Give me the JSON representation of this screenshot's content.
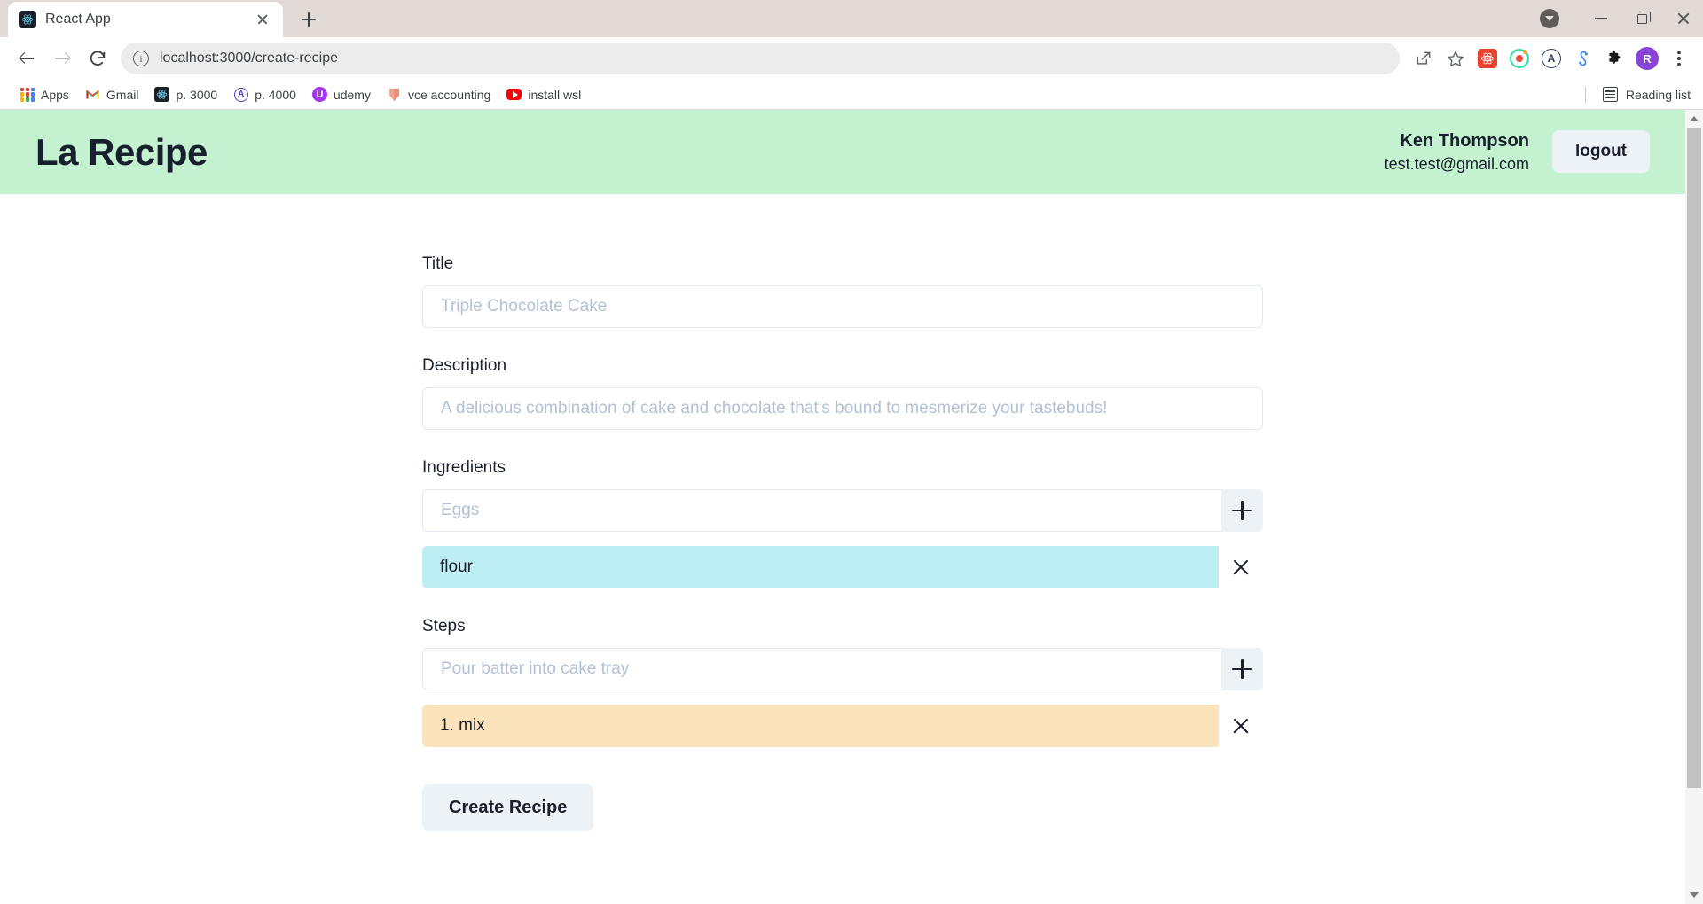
{
  "browser": {
    "tab": {
      "title": "React App",
      "favicon": "react-icon",
      "close_label": "Close tab"
    },
    "new_tab_label": "+",
    "window_controls": {
      "tab_search": "tab-search",
      "minimize": "minimize",
      "maximize": "maximize",
      "close": "close"
    },
    "nav": {
      "back": "back",
      "forward": "forward",
      "reload": "reload"
    },
    "omnibox": {
      "url": "localhost:3000/create-recipe",
      "info_icon": "info-circle-icon",
      "share_icon": "share-icon",
      "star_icon": "star-icon"
    },
    "extensions": [
      {
        "name": "react-devtools",
        "glyph": "⚛"
      },
      {
        "name": "green-target-extension",
        "glyph": ""
      },
      {
        "name": "circled-a-extension",
        "glyph": "A"
      },
      {
        "name": "blue-molecule-extension",
        "glyph": "§"
      },
      {
        "name": "puzzle-extensions",
        "glyph": "🧩"
      }
    ],
    "profile": {
      "initial": "R"
    },
    "menu": "chrome-menu",
    "bookmarks": [
      {
        "label": "Apps",
        "icon": "apps-grid-icon"
      },
      {
        "label": "Gmail",
        "icon": "gmail-icon"
      },
      {
        "label": "p. 3000",
        "icon": "react-icon"
      },
      {
        "label": "p. 4000",
        "icon": "circled-a-icon"
      },
      {
        "label": "udemy",
        "icon": "udemy-icon"
      },
      {
        "label": "vce accounting",
        "icon": "shield-icon"
      },
      {
        "label": "install wsl",
        "icon": "youtube-icon"
      }
    ],
    "reading_list": {
      "label": "Reading list",
      "icon": "reading-list-icon"
    }
  },
  "app": {
    "brand": "La Recipe",
    "header_bg": "#c4f2d0",
    "user": {
      "name": "Ken Thompson",
      "email": "test.test@gmail.com"
    },
    "logout_label": "logout"
  },
  "form": {
    "title_field": {
      "label": "Title",
      "value": "",
      "placeholder": "Triple Chocolate Cake"
    },
    "description_field": {
      "label": "Description",
      "value": "",
      "placeholder": "A delicious combination of cake and chocolate that's bound to mesmerize your tastebuds!"
    },
    "ingredients": {
      "label": "Ingredients",
      "input_value": "",
      "input_placeholder": "Eggs",
      "add_label": "+",
      "items": [
        {
          "text": "flour",
          "color": "#bdeef4",
          "remove_label": "×"
        }
      ]
    },
    "steps": {
      "label": "Steps",
      "input_value": "",
      "input_placeholder": "Pour batter into cake tray",
      "add_label": "+",
      "items": [
        {
          "text": "1. mix",
          "color": "#fbe3bb",
          "remove_label": "×"
        }
      ]
    },
    "submit_label": "Create Recipe"
  }
}
